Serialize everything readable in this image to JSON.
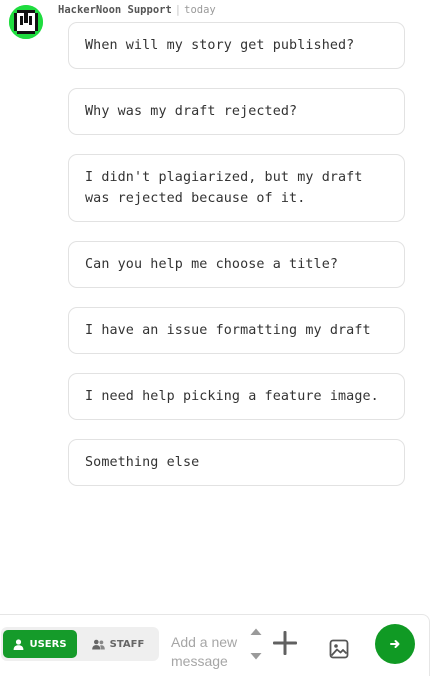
{
  "message": {
    "author": "HackerNoon Support",
    "separator": "|",
    "time": "today"
  },
  "options": [
    {
      "label": "When will my story get published?"
    },
    {
      "label": "Why was my draft rejected?"
    },
    {
      "label": "I didn't plagiarized, but my draft was rejected because of it."
    },
    {
      "label": "Can you help me choose a title?"
    },
    {
      "label": "I have an issue formatting my draft"
    },
    {
      "label": "I need help picking a feature image."
    },
    {
      "label": "Something else"
    }
  ],
  "composer": {
    "users_label": "USERS",
    "staff_label": "STAFF",
    "placeholder": "Add a new message",
    "active_tab": "users"
  },
  "colors": {
    "accent_green": "#159b2a",
    "avatar_green": "#1fdc3f",
    "send_green": "#109a24"
  },
  "icons": {
    "avatar": "hackernoon-logo-icon",
    "users": "user-icon",
    "staff": "users-group-icon",
    "stepper": "up-down-arrows-icon",
    "plus": "plus-icon",
    "image": "image-icon",
    "send": "arrow-right-icon"
  }
}
